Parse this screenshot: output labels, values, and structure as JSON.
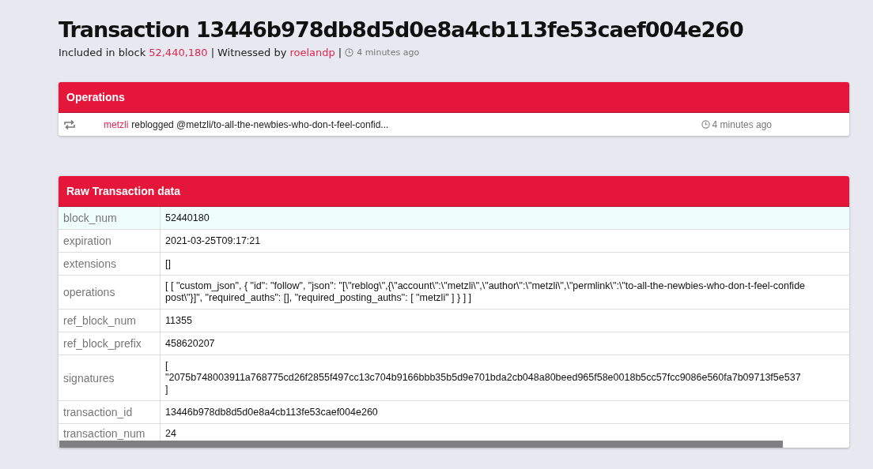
{
  "header": {
    "title": "Transaction 13446b978db8d5d0e8a4cb113fe53caef004e260",
    "included_label": "Included in block",
    "block": "52,440,180",
    "separator": "|",
    "witnessed_label": "Witnessed by",
    "witness": "roelandp",
    "separator_2": "|",
    "time": "4 minutes ago"
  },
  "operations": {
    "title": "Operations",
    "items": [
      {
        "kind": "reblog",
        "account": "metzli",
        "text": "reblogged @metzli/to-all-the-newbies-who-don-t-feel-confid...",
        "time": "4 minutes ago"
      }
    ]
  },
  "raw": {
    "title": "Raw Transaction data",
    "rows": [
      {
        "key": "block_num",
        "lines": [
          "52440180"
        ],
        "selected": true
      },
      {
        "key": "expiration",
        "lines": [
          "2021-03-25T09:17:21"
        ],
        "selected": false
      },
      {
        "key": "extensions",
        "lines": [
          "[]"
        ],
        "selected": false
      },
      {
        "key": "operations",
        "lines": [
          "[ [ \"custom_json\", { \"id\": \"follow\", \"json\": \"[\\\"reblog\\\",{\\\"account\\\":\\\"metzli\\\",\\\"author\\\":\\\"metzli\\\",\\\"permlink\\\":\\\"to-all-the-newbies-who-don-t-feel-confide",
          "post\\\"}]\", \"required_auths\": [], \"required_posting_auths\": [ \"metzli\" ] } ] ]"
        ],
        "selected": false
      },
      {
        "key": "ref_block_num",
        "lines": [
          "11355"
        ],
        "selected": false
      },
      {
        "key": "ref_block_prefix",
        "lines": [
          "458620207"
        ],
        "selected": false
      },
      {
        "key": "signatures",
        "lines": [
          "[",
          "\"2075b748003911a768775cd26f2855f497cc13c704b9166bbb35b5d9e701bda2cb048a80beed965f58e0018b5cc57fcc9086e560fa7b09713f5e537",
          "]"
        ],
        "selected": false
      },
      {
        "key": "transaction_id",
        "lines": [
          "13446b978db8d5d0e8a4cb113fe53caef004e260"
        ],
        "selected": false
      },
      {
        "key": "transaction_num",
        "lines": [
          "24"
        ],
        "selected": false
      }
    ]
  }
}
